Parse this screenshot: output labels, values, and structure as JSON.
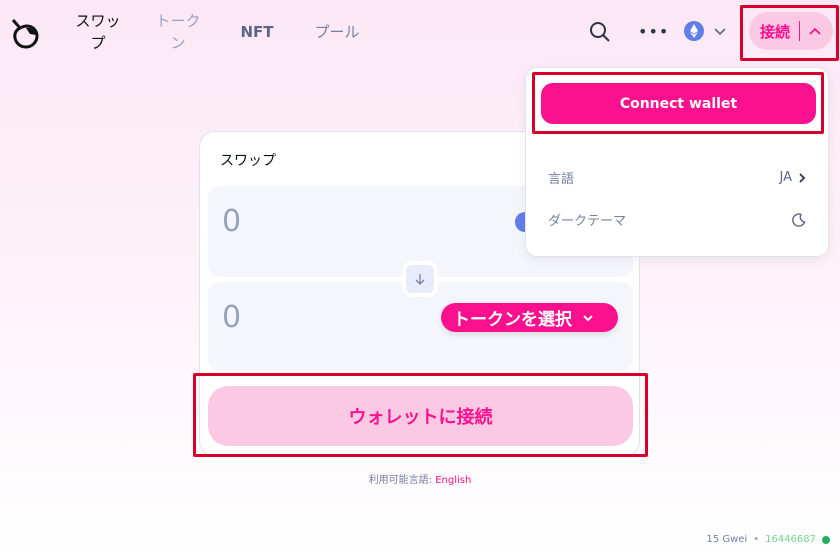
{
  "nav": {
    "tabs": [
      {
        "label": "スワップ",
        "active": true
      },
      {
        "label": "トークン"
      },
      {
        "label": "NFT"
      },
      {
        "label": "プール"
      }
    ],
    "connect_label": "接続",
    "search_icon": "search-icon",
    "more_icon": "more-dots-icon",
    "network_icon": "ethereum-icon"
  },
  "menu": {
    "connect_wallet": "Connect wallet",
    "language_label": "言語",
    "language_value": "JA",
    "dark_theme_label": "ダークテーマ"
  },
  "swap": {
    "title": "スワップ",
    "input_value": "0",
    "output_value": "0",
    "select_token": "トークンを選択",
    "connect_button": "ウォレットに接続"
  },
  "footer": {
    "available_languages": "利用可能言語:",
    "language_link": "English"
  },
  "status": {
    "gas": "15 Gwei",
    "block": "16446687"
  },
  "colors": {
    "accent": "#fb118e",
    "accent_light": "#fbc9e4",
    "status_green": "#27ae60"
  }
}
